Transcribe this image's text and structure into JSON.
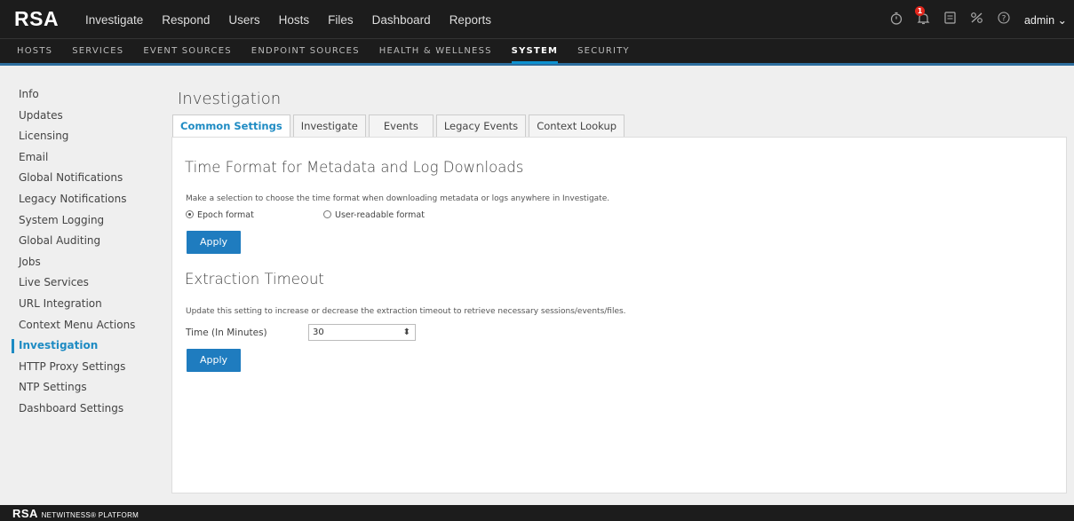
{
  "header": {
    "logo": "RSA",
    "nav": [
      "Investigate",
      "Respond",
      "Users",
      "Hosts",
      "Files",
      "Dashboard",
      "Reports"
    ],
    "notification_count": "1",
    "user": "admin"
  },
  "subnav": {
    "items": [
      "HOSTS",
      "SERVICES",
      "EVENT SOURCES",
      "ENDPOINT SOURCES",
      "HEALTH & WELLNESS",
      "SYSTEM",
      "SECURITY"
    ],
    "active": "SYSTEM"
  },
  "sidebar": {
    "items": [
      "Info",
      "Updates",
      "Licensing",
      "Email",
      "Global Notifications",
      "Legacy Notifications",
      "System Logging",
      "Global Auditing",
      "Jobs",
      "Live Services",
      "URL Integration",
      "Context Menu Actions",
      "Investigation",
      "HTTP Proxy Settings",
      "NTP Settings",
      "Dashboard Settings"
    ],
    "active": "Investigation"
  },
  "main": {
    "title": "Investigation",
    "tabs": [
      "Common Settings",
      "Investigate",
      "Events",
      "Legacy Events",
      "Context Lookup"
    ],
    "active_tab": "Common Settings",
    "time_format": {
      "title": "Time Format for Metadata and Log Downloads",
      "description": "Make a selection to choose the time format when downloading metadata or logs anywhere in Investigate.",
      "options": [
        "Epoch format",
        "User-readable format"
      ],
      "selected": "Epoch format",
      "apply_label": "Apply"
    },
    "extraction": {
      "title": "Extraction Timeout",
      "description": "Update this setting to increase or decrease the extraction timeout to retrieve necessary sessions/events/files.",
      "field_label": "Time (In Minutes)",
      "value": "30",
      "apply_label": "Apply"
    }
  },
  "footer": {
    "brand": "RSA",
    "product": "NETWITNESS® PLATFORM"
  }
}
